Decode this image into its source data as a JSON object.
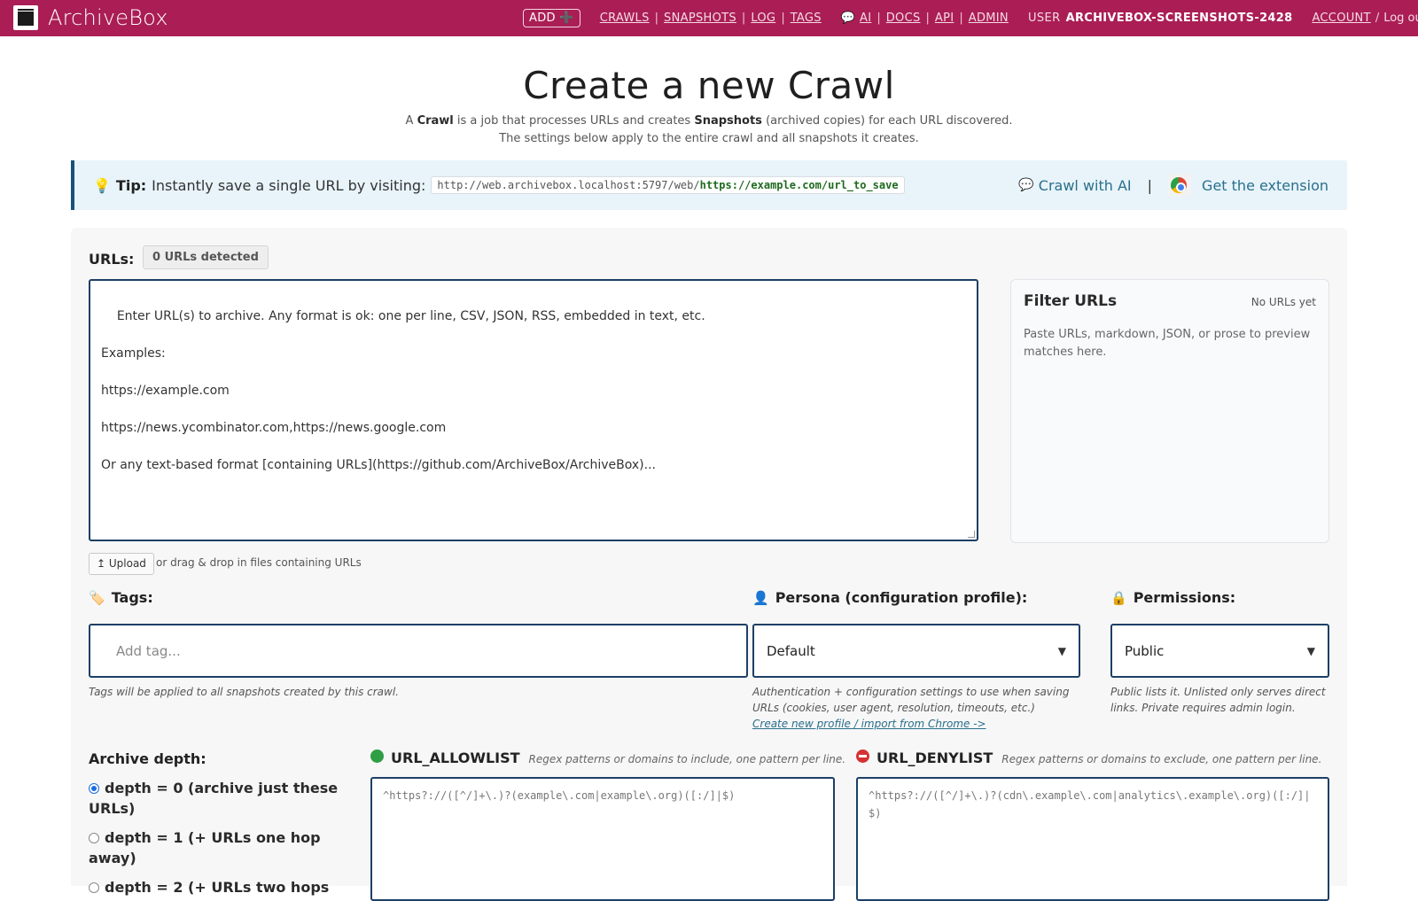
{
  "nav": {
    "brand": "ArchiveBox",
    "add_label": "ADD ➕",
    "links": [
      "CRAWLS",
      "SNAPSHOTS",
      "LOG",
      "TAGS"
    ],
    "ai_label": "AI",
    "docs_label": "DOCS",
    "api_label": "API",
    "admin_label": "ADMIN",
    "user_label": "USER",
    "user_name": "ARCHIVEBOX-SCREENSHOTS-2428",
    "account_label": "ACCOUNT",
    "logout_label": "Log out"
  },
  "header": {
    "title": "Create a new Crawl",
    "line1_a": "A",
    "line1_crawl": "Crawl",
    "line1_b": "is a job that processes URLs and creates",
    "line1_snap": "Snapshots",
    "line1_c": "(archived copies) for each URL discovered.",
    "line2": "The settings below apply to the entire crawl and all snapshots it creates."
  },
  "tip": {
    "label": "Tip:",
    "text": "Instantly save a single URL by visiting:",
    "url_prefix": "http://web.archivebox.localhost:5797/web/",
    "url_example": "https://example.com/url_to_save",
    "crawl_ai": "Crawl with AI",
    "extension": "Get the extension"
  },
  "urls": {
    "label": "URLs:",
    "detected": "0 URLs detected",
    "placeholder": "Enter URL(s) to archive. Any format is ok: one per line, CSV, JSON, RSS, embedded in text, etc.\n\nExamples:\n\nhttps://example.com\n\nhttps://news.ycombinator.com,https://news.google.com\n\nOr any text-based format [containing URLs](https://github.com/ArchiveBox/ArchiveBox)...",
    "upload_label": "↥ Upload",
    "upload_hint": "or drag & drop in files containing URLs"
  },
  "filter": {
    "title": "Filter URLs",
    "count": "No URLs yet",
    "help": "Paste URLs, markdown, JSON, or prose to preview matches here."
  },
  "tags": {
    "label": "Tags:",
    "placeholder": "Add tag...",
    "help": "Tags will be applied to all snapshots created by this crawl."
  },
  "persona": {
    "label": "Persona (configuration profile):",
    "selected": "Default",
    "help": "Authentication + configuration settings to use when saving URLs (cookies, user agent, resolution, timeouts, etc.)",
    "link": "Create new profile / import from Chrome ->"
  },
  "permissions": {
    "label": "Permissions:",
    "selected": "Public",
    "help": "Public lists it. Unlisted only serves direct links. Private requires admin login."
  },
  "depth": {
    "label": "Archive depth:",
    "options": [
      "depth = 0 (archive just these URLs)",
      "depth = 1 (+ URLs one hop away)",
      "depth = 2 (+ URLs two hops"
    ],
    "selected_index": 0
  },
  "allowlist": {
    "title": "URL_ALLOWLIST",
    "hint": "Regex patterns or domains to include, one pattern per line.",
    "placeholder": "^https?://([^/]+\\.)?(example\\.com|example\\.org)([:/]|$)"
  },
  "denylist": {
    "title": "URL_DENYLIST",
    "hint": "Regex patterns or domains to exclude, one pattern per line.",
    "placeholder": "^https?://([^/]+\\.)?(cdn\\.example\\.com|analytics\\.example\\.org)([:/]|$)"
  },
  "colors": {
    "nav_bg": "#aa1e55",
    "field_border": "#1d3f66",
    "tip_bg": "#e8f4fa",
    "link": "#2a6f8c"
  }
}
